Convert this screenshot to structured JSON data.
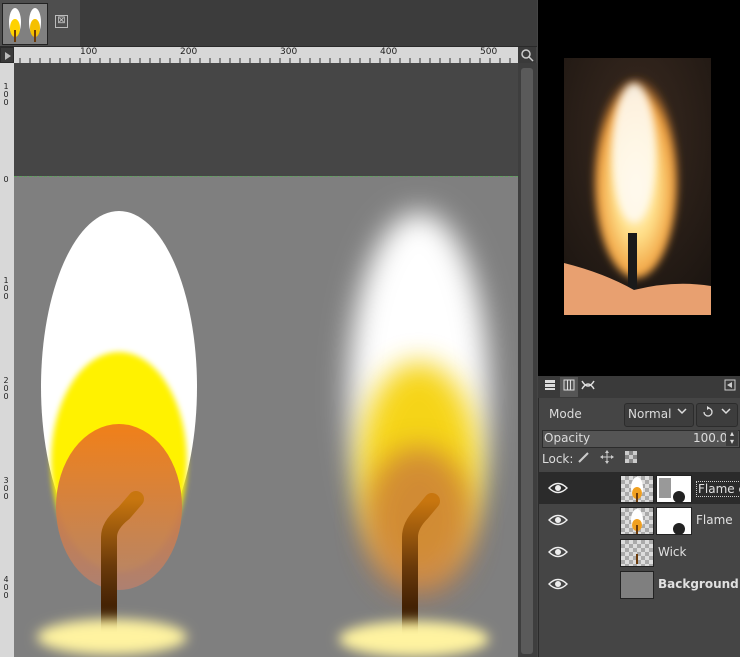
{
  "image_tab": {
    "close_symbol": "⊠"
  },
  "rulers": {
    "horizontal_labels": [
      "100",
      "200",
      "300",
      "400",
      "500"
    ],
    "vertical_labels": [
      "1\n0\n0",
      "0",
      "1\n0\n0",
      "2\n0\n0",
      "3\n0\n0",
      "4\n0\n0"
    ]
  },
  "layers_dock": {
    "mode_label": "Mode",
    "mode_value": "Normal",
    "opacity_label": "Opacity",
    "opacity_value": "100.0",
    "lock_label": "Lock:",
    "layers": [
      {
        "name": "Flame c",
        "has_mask": true,
        "selected": true,
        "bold": false
      },
      {
        "name": "Flame",
        "has_mask": true,
        "selected": false,
        "bold": false
      },
      {
        "name": "Wick",
        "has_mask": false,
        "selected": false,
        "bold": false
      },
      {
        "name": "Background",
        "has_mask": false,
        "selected": false,
        "bold": true
      }
    ]
  },
  "colors": {
    "canvas_bg": "#7f7f7f",
    "flame_white": "#ffffff",
    "flame_yellow": "#fff200",
    "flame_orange": "#f07a1a",
    "wick": "#6b3a0a",
    "wax": "#fff3a0"
  }
}
